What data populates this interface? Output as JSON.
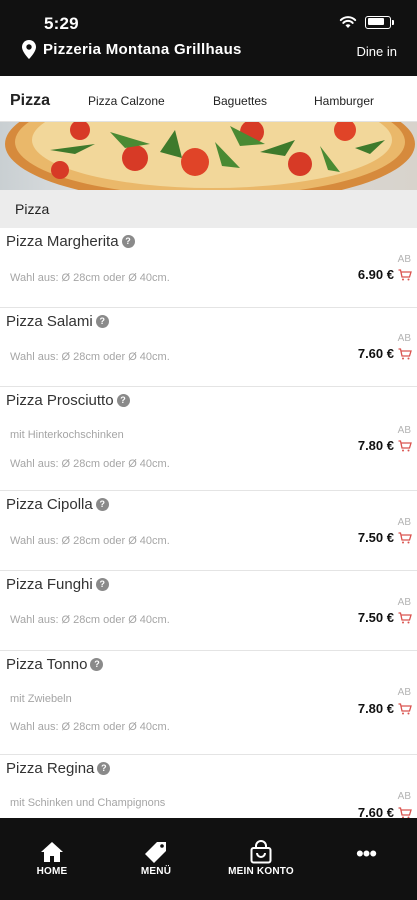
{
  "status": {
    "time": "5:29",
    "battery_level": 0.8
  },
  "header": {
    "restaurant_name": "Pizzeria Montana Grillhaus",
    "mode": "Dine in"
  },
  "tabs": [
    {
      "label": "Pizza",
      "active": true
    },
    {
      "label": "Pizza Calzone",
      "active": false
    },
    {
      "label": "Baguettes",
      "active": false
    },
    {
      "label": "Hamburger",
      "active": false
    }
  ],
  "section": {
    "title": "Pizza"
  },
  "items": [
    {
      "name": "Pizza Margherita",
      "descriptions": [
        "Wahl aus: Ø 28cm oder Ø 40cm."
      ],
      "ab": "AB",
      "price": "6.90 €"
    },
    {
      "name": "Pizza Salami",
      "descriptions": [
        "Wahl aus: Ø 28cm oder Ø 40cm."
      ],
      "ab": "AB",
      "price": "7.60 €"
    },
    {
      "name": "Pizza Prosciutto",
      "descriptions": [
        "mit Hinterkochschinken",
        "Wahl aus: Ø 28cm oder Ø 40cm."
      ],
      "ab": "AB",
      "price": "7.80 €"
    },
    {
      "name": "Pizza Cipolla",
      "descriptions": [
        "Wahl aus: Ø 28cm oder Ø 40cm."
      ],
      "ab": "AB",
      "price": "7.50 €"
    },
    {
      "name": "Pizza Funghi",
      "descriptions": [
        "Wahl aus: Ø 28cm oder Ø 40cm."
      ],
      "ab": "AB",
      "price": "7.50 €"
    },
    {
      "name": "Pizza Tonno",
      "descriptions": [
        "mit Zwiebeln",
        "Wahl aus: Ø 28cm oder Ø 40cm."
      ],
      "ab": "AB",
      "price": "7.80 €"
    },
    {
      "name": "Pizza Regina",
      "descriptions": [
        "mit Schinken und Champignons"
      ],
      "ab": "AB",
      "price": "7.60 €"
    }
  ],
  "bottom_nav": [
    {
      "label": "HOME",
      "icon": "home-icon"
    },
    {
      "label": "MENÜ",
      "icon": "tag-icon"
    },
    {
      "label": "MEIN KONTO",
      "icon": "shopping-bag-icon"
    },
    {
      "label": "",
      "icon": "more-icon"
    }
  ],
  "colors": {
    "accent": "#d9534f",
    "header_bg": "#111111",
    "section_bg": "#ececec"
  }
}
